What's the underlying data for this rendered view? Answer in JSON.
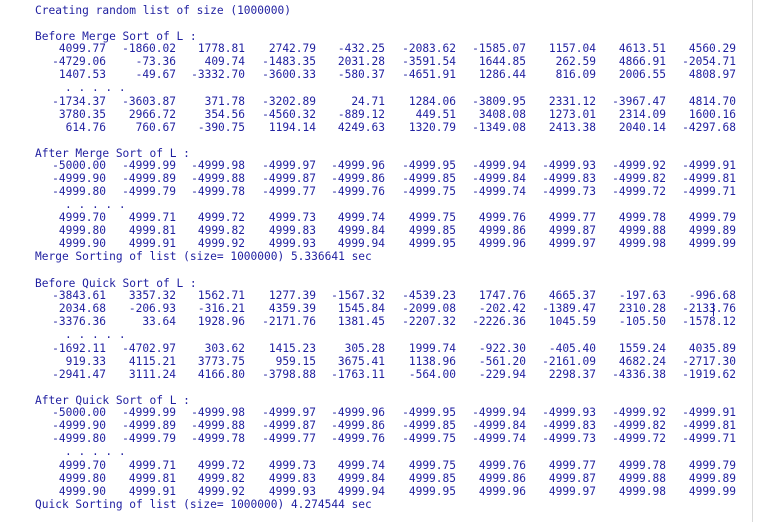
{
  "console": {
    "text_color": "#1f1fa0",
    "background": "#ffffff",
    "messages": {
      "create": "Creating random list of size (1000000)",
      "before_merge": "Before Merge Sort of L :",
      "after_merge": "After Merge Sort of L :",
      "merge_time": "Merge Sorting of list (size= 1000000) 5.336641 sec",
      "before_quick": "Before Quick Sort of L :",
      "after_quick": "After Quick Sort of L :",
      "quick_time": "Quick Sorting of list (size= 1000000) 4.274544 sec"
    },
    "ellipsis": ". . . . .",
    "blocks": {
      "before_merge_head": [
        [
          "4099.77",
          "-1860.02",
          "1778.81",
          "2742.79",
          "-432.25",
          "-2083.62",
          "-1585.07",
          "1157.04",
          "4613.51",
          "4560.29"
        ],
        [
          "-4729.06",
          "-73.36",
          "409.74",
          "-1483.35",
          "2031.28",
          "-3591.54",
          "1644.85",
          "262.59",
          "4866.91",
          "-2054.71"
        ],
        [
          "1407.53",
          "-49.67",
          "-3332.70",
          "-3600.33",
          "-580.37",
          "-4651.91",
          "1286.44",
          "816.09",
          "2006.55",
          "4808.97"
        ]
      ],
      "before_merge_tail": [
        [
          "-1734.37",
          "-3603.87",
          "371.78",
          "-3202.89",
          "24.71",
          "1284.06",
          "-3809.95",
          "2331.12",
          "-3967.47",
          "4814.70"
        ],
        [
          "3780.35",
          "2966.72",
          "354.56",
          "-4560.32",
          "-889.12",
          "449.51",
          "3408.08",
          "1273.01",
          "2314.09",
          "1600.16"
        ],
        [
          "614.76",
          "760.67",
          "-390.75",
          "1194.14",
          "4249.63",
          "1320.79",
          "-1349.08",
          "2413.38",
          "2040.14",
          "-4297.68"
        ]
      ],
      "after_merge_head": [
        [
          "-5000.00",
          "-4999.99",
          "-4999.98",
          "-4999.97",
          "-4999.96",
          "-4999.95",
          "-4999.94",
          "-4999.93",
          "-4999.92",
          "-4999.91"
        ],
        [
          "-4999.90",
          "-4999.89",
          "-4999.88",
          "-4999.87",
          "-4999.86",
          "-4999.85",
          "-4999.84",
          "-4999.83",
          "-4999.82",
          "-4999.81"
        ],
        [
          "-4999.80",
          "-4999.79",
          "-4999.78",
          "-4999.77",
          "-4999.76",
          "-4999.75",
          "-4999.74",
          "-4999.73",
          "-4999.72",
          "-4999.71"
        ]
      ],
      "after_merge_tail": [
        [
          "4999.70",
          "4999.71",
          "4999.72",
          "4999.73",
          "4999.74",
          "4999.75",
          "4999.76",
          "4999.77",
          "4999.78",
          "4999.79"
        ],
        [
          "4999.80",
          "4999.81",
          "4999.82",
          "4999.83",
          "4999.84",
          "4999.85",
          "4999.86",
          "4999.87",
          "4999.88",
          "4999.89"
        ],
        [
          "4999.90",
          "4999.91",
          "4999.92",
          "4999.93",
          "4999.94",
          "4999.95",
          "4999.96",
          "4999.97",
          "4999.98",
          "4999.99"
        ]
      ],
      "before_quick_head": [
        [
          "-3843.61",
          "3357.32",
          "1562.71",
          "1277.39",
          "-1567.32",
          "-4539.23",
          "1747.76",
          "4665.37",
          "-197.63",
          "-996.68"
        ],
        [
          "2034.68",
          "-206.93",
          "-316.21",
          "4359.39",
          "1545.84",
          "-2099.08",
          "-202.42",
          "-1389.47",
          "2310.28",
          "-2133.76"
        ],
        [
          "-3376.36",
          "33.64",
          "1928.96",
          "-2171.76",
          "1381.45",
          "-2207.32",
          "-2226.36",
          "1045.59",
          "-105.50",
          "-1578.12"
        ]
      ],
      "before_quick_tail": [
        [
          "-1692.11",
          "-4702.97",
          "303.62",
          "1415.23",
          "305.28",
          "1999.74",
          "-922.30",
          "-405.40",
          "1559.24",
          "4035.89"
        ],
        [
          "919.33",
          "4115.21",
          "3773.75",
          "959.15",
          "3675.41",
          "1138.96",
          "-561.20",
          "-2161.09",
          "4682.24",
          "-2717.30"
        ],
        [
          "-2941.47",
          "3111.24",
          "4166.80",
          "-3798.88",
          "-1763.11",
          "-564.00",
          "-229.94",
          "2298.37",
          "-4336.38",
          "-1919.62"
        ]
      ],
      "after_quick_head": [
        [
          "-5000.00",
          "-4999.99",
          "-4999.98",
          "-4999.97",
          "-4999.96",
          "-4999.95",
          "-4999.94",
          "-4999.93",
          "-4999.92",
          "-4999.91"
        ],
        [
          "-4999.90",
          "-4999.89",
          "-4999.88",
          "-4999.87",
          "-4999.86",
          "-4999.85",
          "-4999.84",
          "-4999.83",
          "-4999.82",
          "-4999.81"
        ],
        [
          "-4999.80",
          "-4999.79",
          "-4999.78",
          "-4999.77",
          "-4999.76",
          "-4999.75",
          "-4999.74",
          "-4999.73",
          "-4999.72",
          "-4999.71"
        ]
      ],
      "after_quick_tail": [
        [
          "4999.70",
          "4999.71",
          "4999.72",
          "4999.73",
          "4999.74",
          "4999.75",
          "4999.76",
          "4999.77",
          "4999.78",
          "4999.79"
        ],
        [
          "4999.80",
          "4999.81",
          "4999.82",
          "4999.83",
          "4999.84",
          "4999.85",
          "4999.86",
          "4999.87",
          "4999.88",
          "4999.89"
        ],
        [
          "4999.90",
          "4999.91",
          "4999.92",
          "4999.93",
          "4999.94",
          "4999.95",
          "4999.96",
          "4999.97",
          "4999.98",
          "4999.99"
        ]
      ]
    }
  }
}
